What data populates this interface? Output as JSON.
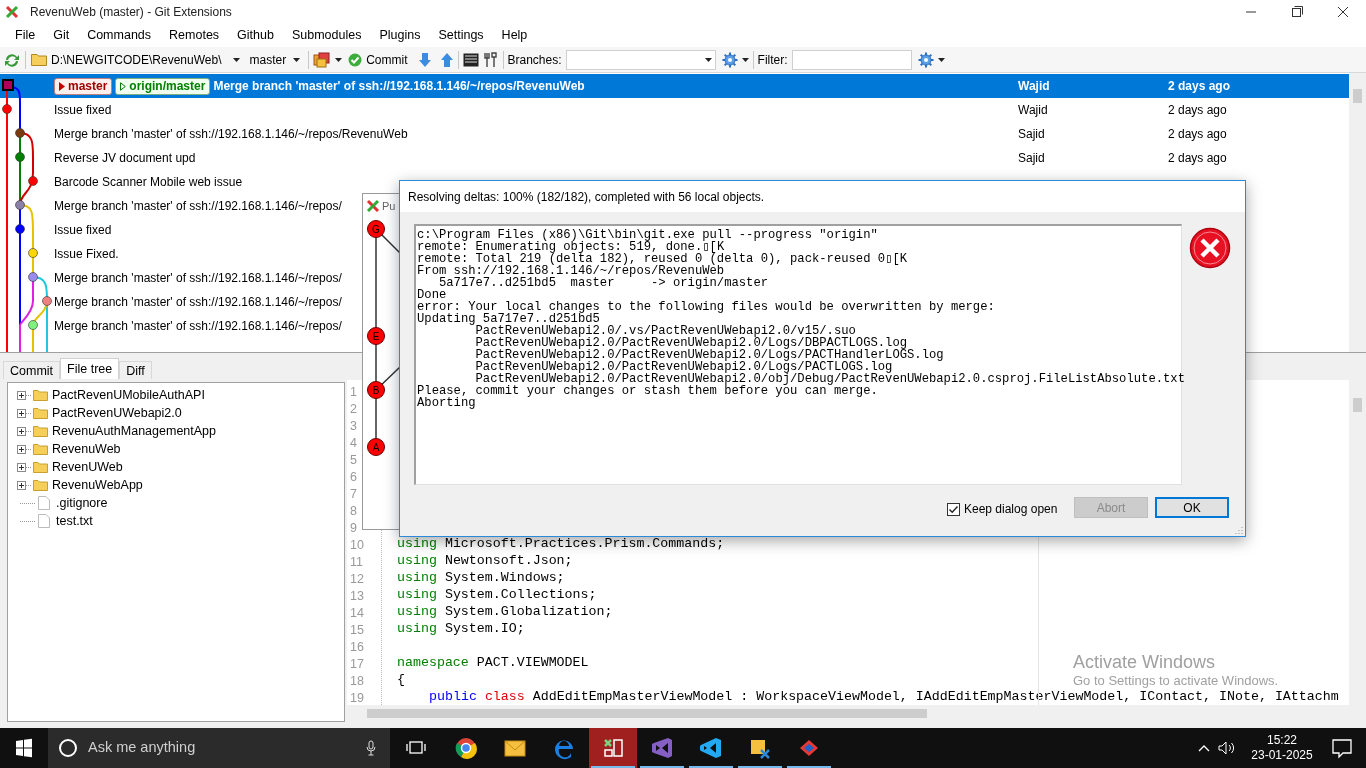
{
  "window": {
    "title": "RevenuWeb (master) - Git Extensions"
  },
  "menu": [
    "File",
    "Git",
    "Commands",
    "Remotes",
    "Github",
    "Submodules",
    "Plugins",
    "Settings",
    "Help"
  ],
  "toolbar": {
    "repository": "D:\\NEWGITCODE\\RevenuWeb\\",
    "branch": "master",
    "commit": "Commit",
    "branches_label": "Branches:",
    "filter_label": "Filter:"
  },
  "commits": [
    {
      "message": "Merge branch 'master' of ssh://192.168.1.146/~/repos/RevenuWeb",
      "author": "Wajid",
      "date": "2 days ago",
      "selected": true,
      "color": "#b0005a",
      "refs": [
        {
          "name": "master",
          "kind": "local"
        },
        {
          "name": "origin/master",
          "kind": "remote"
        }
      ]
    },
    {
      "message": "Issue fixed",
      "author": "Wajid",
      "date": "2 days ago",
      "selected": false,
      "color": "#ff0000"
    },
    {
      "message": "Merge branch 'master' of ssh://192.168.1.146/~/repos/RevenuWeb",
      "author": "Sajid",
      "date": "2 days ago",
      "selected": false,
      "color": "#7a3a10"
    },
    {
      "message": "Reverse JV document upd",
      "author": "Sajid",
      "date": "2 days ago",
      "selected": false,
      "color": "#008000"
    },
    {
      "message": "Barcode Scanner Mobile web issue",
      "selected": false,
      "color": "#ff0000"
    },
    {
      "message": "Merge branch 'master' of ssh://192.168.1.146/~/repos/",
      "selected": false,
      "color": "#8a80a8"
    },
    {
      "message": "Issue fixed",
      "selected": false,
      "color": "#0000ff"
    },
    {
      "message": "Issue Fixed.",
      "selected": false,
      "color": "#ffd700"
    },
    {
      "message": "Merge branch 'master' of ssh://192.168.1.146/~/repos/",
      "selected": false,
      "color": "#9a8af0"
    },
    {
      "message": "Merge branch 'master' of ssh://192.168.1.146/~/repos/",
      "selected": false,
      "color": "#f08080"
    },
    {
      "message": "Merge branch 'master' of ssh://192.168.1.146/~/repos/",
      "selected": false,
      "color": "#80f080"
    }
  ],
  "bottom_tabs": [
    {
      "label": "Commit",
      "selected": false
    },
    {
      "label": "File tree",
      "selected": true
    },
    {
      "label": "Diff",
      "selected": false
    }
  ],
  "file_tree": [
    {
      "name": "PactRevenUMobileAuthAPI",
      "kind": "folder",
      "expanded": false
    },
    {
      "name": "PactRevenUWebapi2.0",
      "kind": "folder",
      "expanded": false
    },
    {
      "name": "RevenuAuthManagementApp",
      "kind": "folder",
      "expanded": false
    },
    {
      "name": "RevenuWeb",
      "kind": "folder",
      "expanded": false
    },
    {
      "name": "RevenUWeb",
      "kind": "folder",
      "expanded": false
    },
    {
      "name": "RevenuWebApp",
      "kind": "folder",
      "expanded": false
    },
    {
      "name": ".gitignore",
      "kind": "file"
    },
    {
      "name": "test.txt",
      "kind": "file"
    }
  ],
  "code_lines": [
    {
      "number": "1"
    },
    {
      "number": "2"
    },
    {
      "number": "3"
    },
    {
      "number": "4"
    },
    {
      "number": "5"
    },
    {
      "number": "6"
    },
    {
      "number": "7"
    },
    {
      "number": "8"
    },
    {
      "number": "9"
    },
    {
      "number": "10",
      "tokens": [
        {
          "text": "using",
          "kind": "directive"
        },
        {
          "text": "Microsoft.Practices.Prism.Commands;",
          "kind": "plain"
        }
      ]
    },
    {
      "number": "11",
      "tokens": [
        {
          "text": "using",
          "kind": "directive"
        },
        {
          "text": "Newtonsoft.Json;",
          "kind": "plain"
        }
      ]
    },
    {
      "number": "12",
      "tokens": [
        {
          "text": "using",
          "kind": "directive"
        },
        {
          "text": "System.Windows;",
          "kind": "plain"
        }
      ]
    },
    {
      "number": "13",
      "tokens": [
        {
          "text": "using",
          "kind": "directive"
        },
        {
          "text": "System.Collections;",
          "kind": "plain"
        }
      ]
    },
    {
      "number": "14",
      "tokens": [
        {
          "text": "using",
          "kind": "directive"
        },
        {
          "text": "System.Globalization;",
          "kind": "plain"
        }
      ]
    },
    {
      "number": "15",
      "tokens": [
        {
          "text": "using",
          "kind": "directive"
        },
        {
          "text": "System.IO;",
          "kind": "plain"
        }
      ]
    },
    {
      "number": "16"
    },
    {
      "number": "17",
      "tokens": [
        {
          "text": "namespace",
          "kind": "directive"
        },
        {
          "text": "PACT.VIEWMODEL",
          "kind": "plain"
        }
      ]
    },
    {
      "number": "18",
      "tokens": [
        {
          "text": "{",
          "kind": "plain"
        }
      ]
    },
    {
      "number": "19",
      "indented": true,
      "tokens": [
        {
          "text": "public",
          "kind": "keyword"
        },
        {
          "text": "class",
          "kind": "declaration"
        },
        {
          "text": "AddEditEmpMasterViewModel : WorkspaceViewModel, IAddEditEmpMasterViewModel, IContact, INote, IAttachm",
          "kind": "plain"
        }
      ]
    }
  ],
  "pull_dialog": {
    "title": "Pu",
    "nodes": [
      "G",
      "E",
      "B",
      "A"
    ]
  },
  "progress_dialog": {
    "title": "Resolving deltas: 100% (182/182), completed with 56 local objects.",
    "output": [
      "c:\\Program Files (x86)\\Git\\bin\\git.exe pull --progress \"origin\"",
      "remote: Enumerating objects: 519, done.▯[K",
      "remote: Total 219 (delta 182), reused 0 (delta 0), pack-reused 0▯[K",
      "From ssh://192.168.1.146/~/repos/RevenuWeb",
      "   5a717e7..d251bd5  master     -> origin/master",
      "Done",
      "error: Your local changes to the following files would be overwritten by merge:",
      "Updating 5a717e7..d251bd5",
      "\tPactRevenUWebapi2.0/.vs/PactRevenUWebapi2.0/v15/.suo",
      "\tPactRevenUWebapi2.0/PactRevenUWebapi2.0/Logs/DBPACTLOGS.log",
      "\tPactRevenUWebapi2.0/PactRevenUWebapi2.0/Logs/PACTHandlerLOGS.log",
      "\tPactRevenUWebapi2.0/PactRevenUWebapi2.0/Logs/PACTLOGS.log",
      "\tPactRevenUWebapi2.0/PactRevenUWebapi2.0/obj/Debug/PactRevenUWebapi2.0.csproj.FileListAbsolute.txt",
      "Please, commit your changes or stash them before you can merge.",
      "Aborting"
    ],
    "keep_open": {
      "label": "Keep dialog open",
      "checked": true
    },
    "buttons": [
      {
        "label": "Abort",
        "disabled": true
      },
      {
        "label": "OK",
        "disabled": false
      }
    ]
  },
  "watermark": {
    "title": "Activate Windows",
    "subtitle": "Go to Settings to activate Windows."
  },
  "taskbar": {
    "search_placeholder": "Ask me anything",
    "time": "15:22",
    "date": "23-01-2025",
    "apps": [
      {
        "kind": "ring",
        "running": false,
        "active": false
      },
      {
        "kind": "mail",
        "running": false,
        "active": false
      },
      {
        "kind": "browser",
        "running": false,
        "active": false
      },
      {
        "kind": "git",
        "running": true,
        "active": true
      },
      {
        "kind": "studio",
        "running": true,
        "active": false
      },
      {
        "kind": "editor",
        "running": true,
        "active": false
      },
      {
        "kind": "tool",
        "running": true,
        "active": false
      },
      {
        "kind": "diamond",
        "running": true,
        "active": false
      }
    ]
  }
}
